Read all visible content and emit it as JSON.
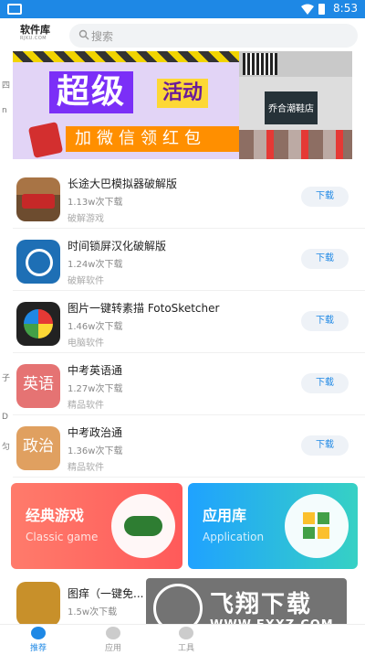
{
  "status_bar": {
    "time": "8:53"
  },
  "header": {
    "logo_text": "软件库",
    "logo_sub": "RJKU.COM",
    "search_placeholder": "搜索"
  },
  "left_strip": [
    "四",
    "n",
    "子",
    "D",
    "匀"
  ],
  "banner": {
    "big_text": "超级",
    "activity_text": "活动",
    "sub_text": "加微信领红包",
    "shop_name": "乔合潮鞋店"
  },
  "apps": [
    {
      "name": "长途大巴模拟器破解版",
      "downloads": "1.13w次下载",
      "category": "破解游戏",
      "button": "下载",
      "icon": "bus-icon"
    },
    {
      "name": "时间锁屏汉化破解版",
      "downloads": "1.24w次下载",
      "category": "破解软件",
      "button": "下载",
      "icon": "clock-icon"
    },
    {
      "name": "图片一键转素描 FotoSketcher",
      "downloads": "1.46w次下载",
      "category": "电脑软件",
      "button": "下载",
      "icon": "foto-icon"
    },
    {
      "name": "中考英语通",
      "downloads": "1.27w次下载",
      "category": "精品软件",
      "button": "下载",
      "icon_text": "英语"
    },
    {
      "name": "中考政治通",
      "downloads": "1.36w次下载",
      "category": "精品软件",
      "button": "下载",
      "icon_text": "政治"
    }
  ],
  "cards": {
    "games": {
      "title": "经典游戏",
      "subtitle": "Classic game"
    },
    "apps": {
      "title": "应用库",
      "subtitle": "Application"
    }
  },
  "bottom_app": {
    "name": "图痒（一键免...",
    "downloads": "1.5w次下载"
  },
  "watermark": {
    "text": "飞翔下载",
    "url": "WWW.FXXZ.COM"
  },
  "tabs": [
    {
      "label": "推荐",
      "active": true
    },
    {
      "label": "应用"
    },
    {
      "label": "工具"
    }
  ],
  "colors": {
    "accent": "#1e88e5",
    "games_card": "#ff6b5f",
    "apps_card": "#1fa2ff"
  }
}
